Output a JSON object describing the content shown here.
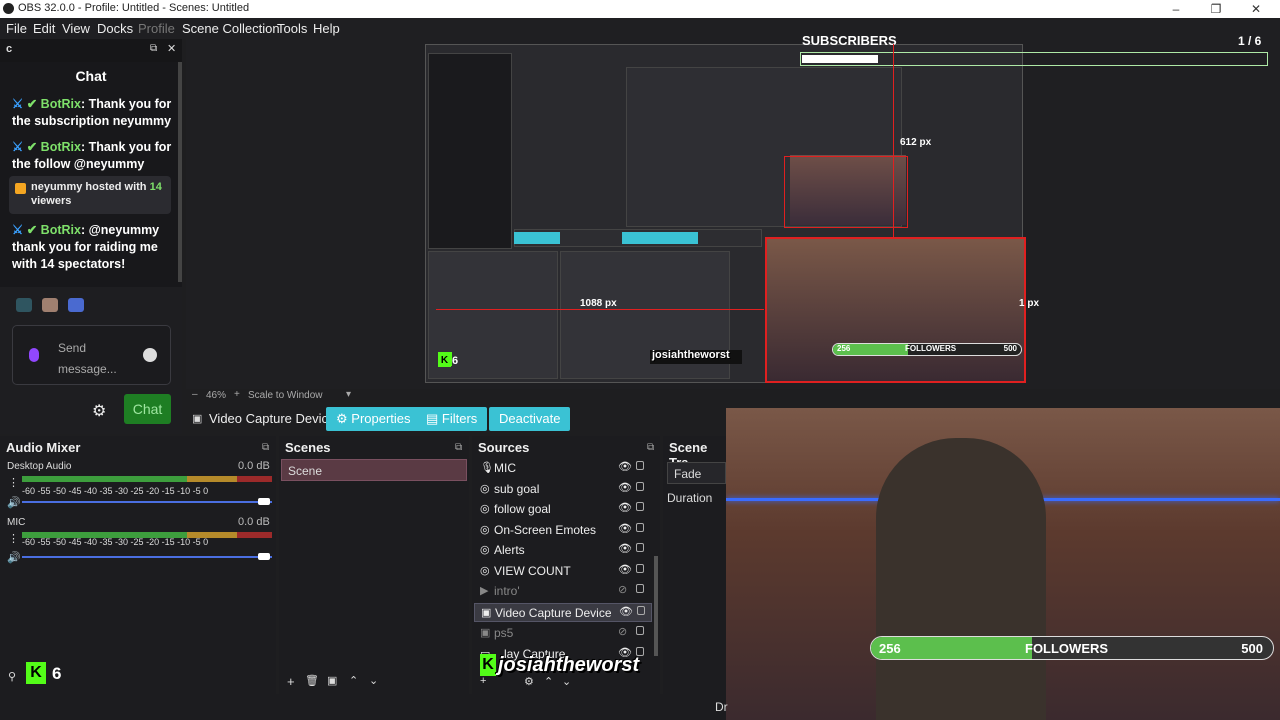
{
  "titlebar": {
    "title": "OBS 32.0.0 - Profile: Untitled - Scenes: Untitled",
    "minimize": "–",
    "maximize": "❐",
    "close": "✕"
  },
  "menu": {
    "file": "File",
    "edit": "Edit",
    "view": "View",
    "docks": "Docks",
    "profile": "Profile",
    "scene_collection": "Scene Collection",
    "tools": "Tools",
    "help": "Help"
  },
  "chat_dock": {
    "dock_title": "c",
    "panel_title": "Chat",
    "messages": [
      {
        "user": "BotRix",
        "text": ": Thank you for the subscription neyummy"
      },
      {
        "user": "BotRix",
        "text": ": Thank you for the follow @neyummy"
      },
      {
        "user": "BotRix",
        "text": ": @neyummy thank you for raiding me with 14 spectators!"
      }
    ],
    "host_notice": {
      "user": "neyummy",
      "mid": " hosted with ",
      "count": "14",
      "suffix": "viewers"
    },
    "send_placeholder": "Send message...",
    "chat_button": "Chat"
  },
  "overlay": {
    "subscribers_label": "SUBSCRIBERS",
    "subscribers_count": "1  / 6",
    "px_612": "612 px",
    "px_1088": "1088 px",
    "px_1": "1 px",
    "followers_current": "256",
    "followers_label": "FOLLOWERS",
    "followers_goal": "500",
    "followers_fraction": 0.4,
    "kick_count": "6",
    "channel_name": "josiahtheworst"
  },
  "zoom": {
    "level": "46%",
    "mode": "Scale to Window"
  },
  "source_toolbar": {
    "source_name": "Video Capture Devic",
    "properties": "Properties",
    "filters": "Filters",
    "deactivate": "Deactivate"
  },
  "audio_mixer": {
    "title": "Audio Mixer",
    "ticks": "-60  -55  -50  -45  -40  -35  -30  -25  -20  -15  -10   -5    0",
    "channels": [
      {
        "name": "Desktop Audio",
        "db": "0.0 dB"
      },
      {
        "name": "MIC",
        "db": "0.0 dB"
      }
    ]
  },
  "scenes": {
    "title": "Scenes",
    "items": [
      "Scene"
    ]
  },
  "sources": {
    "title": "Sources",
    "items": [
      {
        "name": "MIC",
        "icon": "mic-icon"
      },
      {
        "name": "sub goal",
        "icon": "globe-icon"
      },
      {
        "name": "follow goal",
        "icon": "globe-icon"
      },
      {
        "name": "On-Screen Emotes",
        "icon": "globe-icon"
      },
      {
        "name": "Alerts",
        "icon": "globe-icon"
      },
      {
        "name": "VIEW COUNT",
        "icon": "globe-icon"
      },
      {
        "name": "intro'",
        "icon": "play-icon"
      },
      {
        "name": "Video Capture Device",
        "icon": "camera-icon"
      },
      {
        "name": "ps5",
        "icon": "camera-icon"
      },
      {
        "name": "lay Capture",
        "icon": "monitor-icon"
      }
    ]
  },
  "scene_transitions": {
    "title": "Scene Tra",
    "transition": "Fade",
    "duration_label": "Duration"
  },
  "status": {
    "tail": "Dr"
  }
}
